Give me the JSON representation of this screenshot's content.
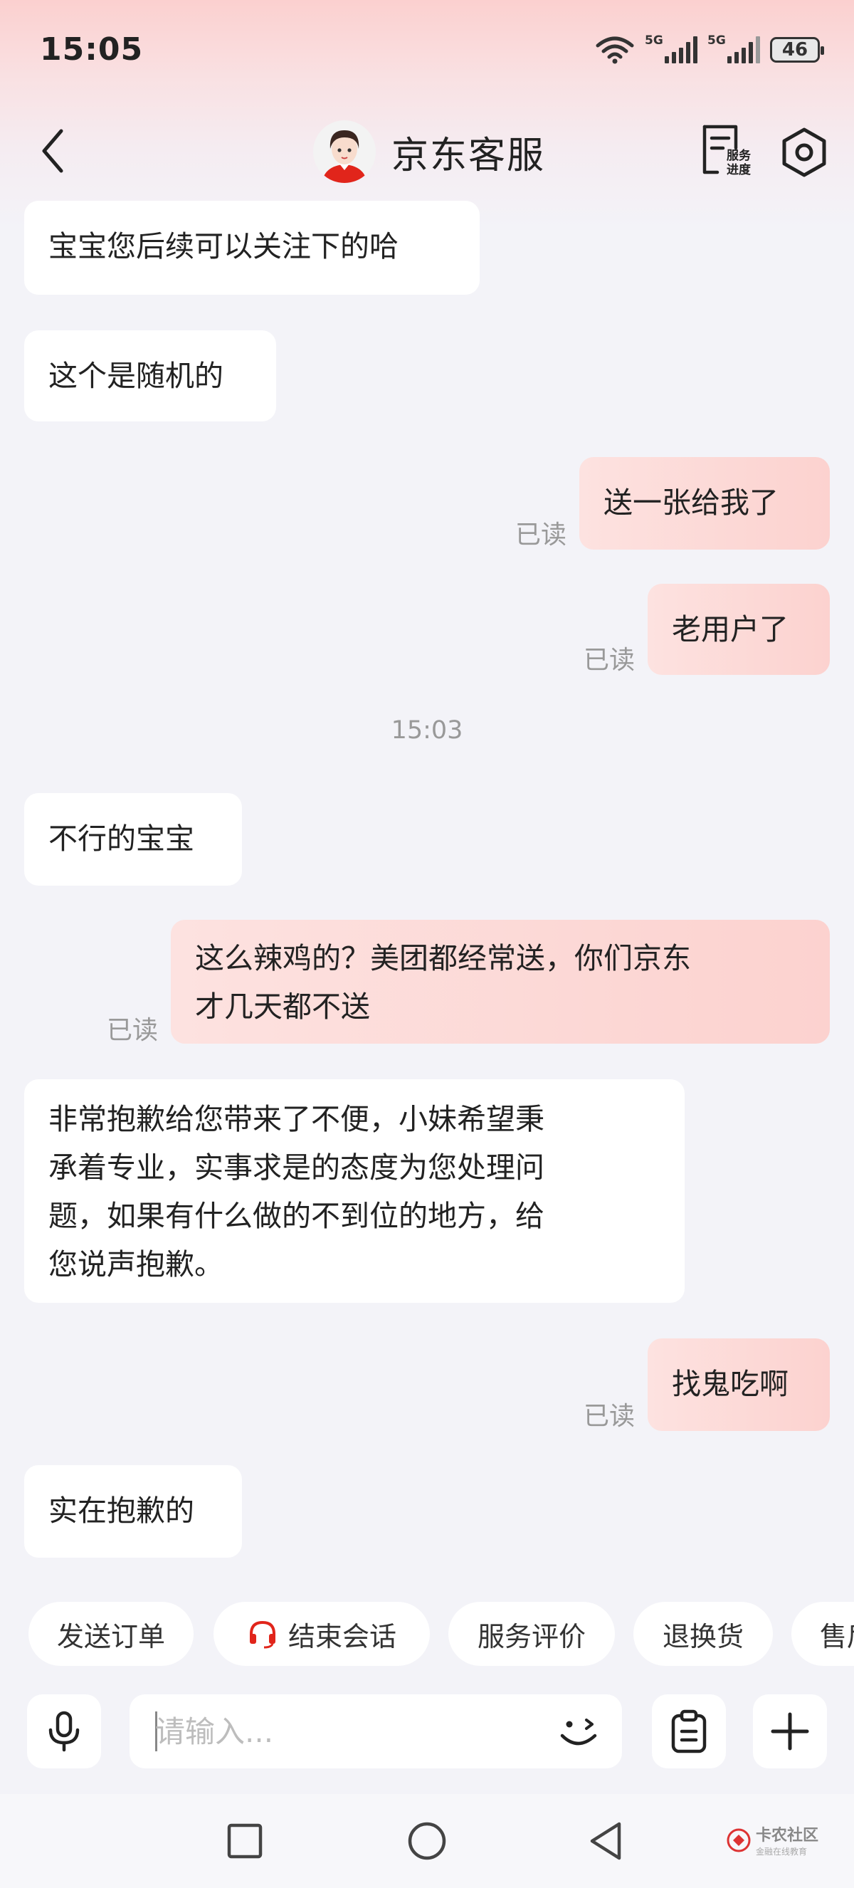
{
  "status_bar": {
    "time": "15:05",
    "network1": "5G",
    "network2": "5G",
    "battery": "46"
  },
  "header": {
    "title": "京东客服",
    "progress_label": "服务\n进度"
  },
  "messages": [
    {
      "side": "left",
      "text": "宝宝您后续可以关注下的哈"
    },
    {
      "side": "left",
      "text": "这个是随机的"
    },
    {
      "side": "right",
      "text": "送一张给我了",
      "status": "已读"
    },
    {
      "side": "right",
      "text": "老用户了",
      "status": "已读"
    },
    {
      "side": "left",
      "text": "不行的宝宝"
    },
    {
      "side": "right",
      "text": "这么辣鸡的？美团都经常送，你们京东\n才几天都不送",
      "status": "已读"
    },
    {
      "side": "left",
      "text": "非常抱歉给您带来了不便，小妹希望秉\n承着专业，实事求是的态度为您处理问\n题，如果有什么做的不到位的地方，给\n您说声抱歉。"
    },
    {
      "side": "right",
      "text": "找鬼吃啊",
      "status": "已读"
    },
    {
      "side": "left",
      "text": "实在抱歉的"
    }
  ],
  "timestamp": "15:03",
  "quick_actions": [
    "发送订单",
    "结束会话",
    "服务评价",
    "退换货",
    "售后"
  ],
  "input": {
    "placeholder": "请输入..."
  },
  "icons": {
    "back": "chevron-left-icon",
    "settings": "hexagon-gear-icon",
    "progress": "document-progress-icon",
    "voice": "microphone-icon",
    "emoji": "wink-emoji-icon",
    "clipboard": "clipboard-icon",
    "add": "plus-icon",
    "headset": "headset-icon"
  },
  "colors": {
    "accent": "#e1251b",
    "bubble_right": "#fcd6d3",
    "bubble_left": "#ffffff",
    "background": "#f3f3f8"
  },
  "watermark": {
    "text": "卡农社区",
    "sub": "金融在线教育"
  }
}
